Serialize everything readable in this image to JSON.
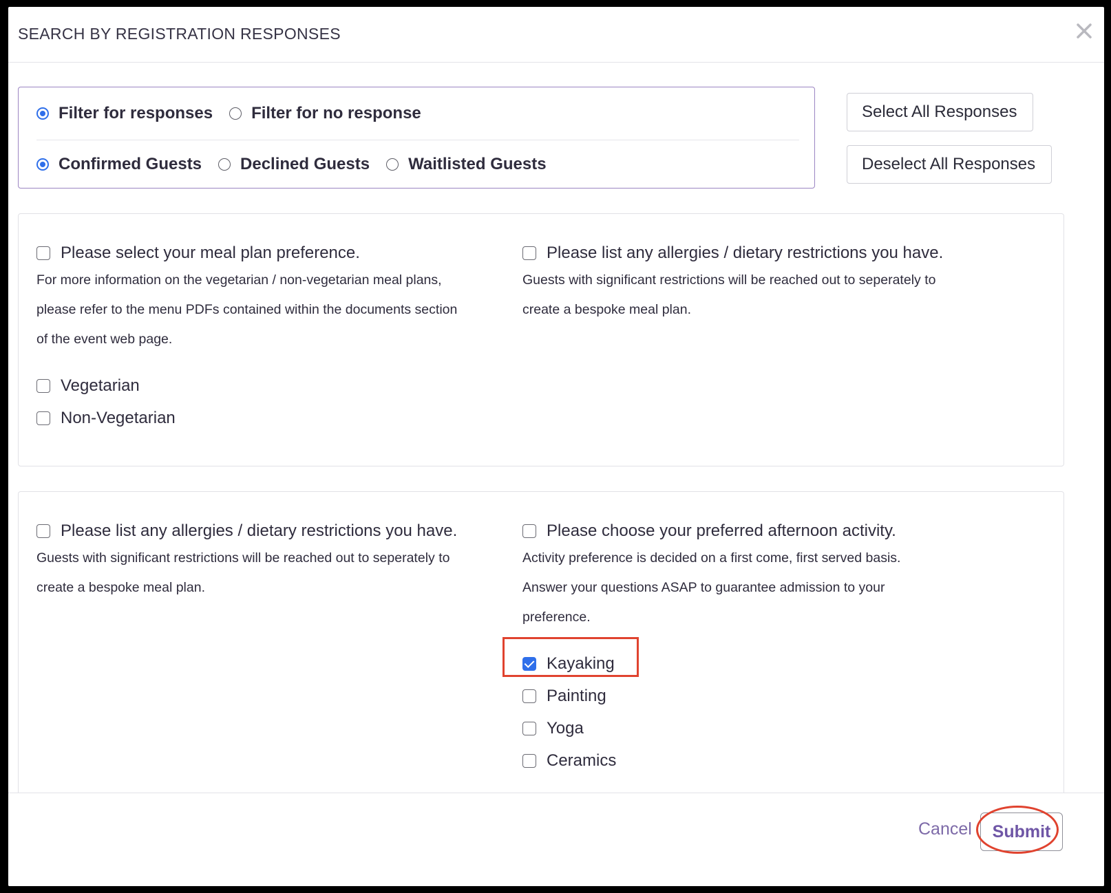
{
  "modal": {
    "title": "SEARCH BY REGISTRATION RESPONSES"
  },
  "filters": {
    "response_options": [
      {
        "label": "Filter for responses",
        "checked": true
      },
      {
        "label": "Filter for no response",
        "checked": false
      }
    ],
    "guest_options": [
      {
        "label": "Confirmed Guests",
        "checked": true
      },
      {
        "label": "Declined Guests",
        "checked": false
      },
      {
        "label": "Waitlisted Guests",
        "checked": false
      }
    ]
  },
  "actions": {
    "select_all": "Select All Responses",
    "deselect_all": "Deselect All Responses"
  },
  "questions": [
    {
      "title": "Please select your meal plan preference.",
      "description": "For more information on the vegetarian / non-vegetarian meal plans,\nplease refer to the menu PDFs contained within the documents section\nof the event web page.",
      "options": [
        {
          "label": "Vegetarian",
          "checked": false
        },
        {
          "label": "Non-Vegetarian",
          "checked": false
        }
      ]
    },
    {
      "title": "Please list any allergies / dietary restrictions you have.",
      "description": "Guests with significant restrictions will be reached out to seperately to\ncreate a bespoke meal plan.",
      "options": []
    },
    {
      "title": "Please list any allergies / dietary restrictions you have.",
      "description": "Guests with significant restrictions will be reached out to seperately to\ncreate a bespoke meal plan.",
      "options": []
    },
    {
      "title": "Please choose your preferred afternoon activity.",
      "description": "Activity preference is decided on a first come, first served basis.\nAnswer your questions ASAP to guarantee admission to your\npreference.",
      "options": [
        {
          "label": "Kayaking",
          "checked": true
        },
        {
          "label": "Painting",
          "checked": false
        },
        {
          "label": "Yoga",
          "checked": false
        },
        {
          "label": "Ceramics",
          "checked": false
        }
      ]
    }
  ],
  "footer": {
    "cancel": "Cancel",
    "submit": "Submit"
  },
  "colors": {
    "accent": "#2f6fea",
    "brand_purple": "#6f56a6",
    "annotation_red": "#e0432f"
  }
}
